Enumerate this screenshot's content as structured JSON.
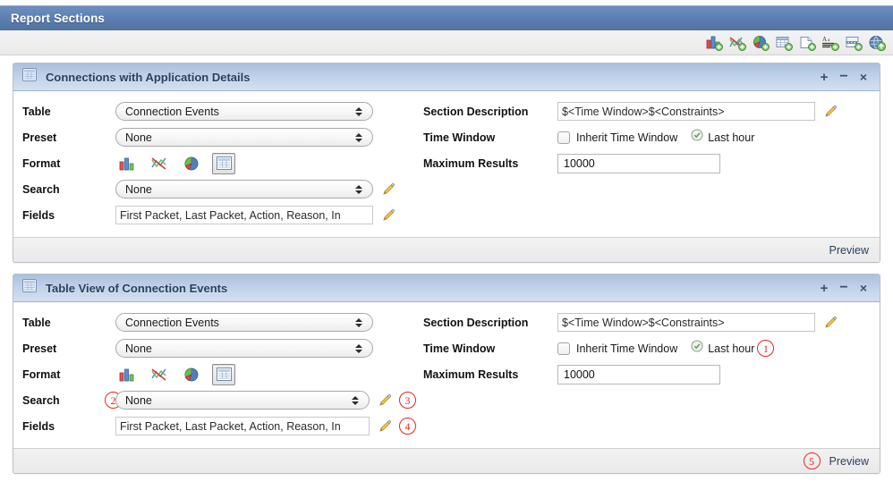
{
  "window": {
    "title": "Report Sections"
  },
  "toolbar": {
    "icons": [
      {
        "name": "add-bar-chart-icon",
        "tooltip": "Add Bar Chart Section"
      },
      {
        "name": "add-line-chart-icon",
        "tooltip": "Add Line Chart Section"
      },
      {
        "name": "add-pie-chart-icon",
        "tooltip": "Add Pie Chart Section"
      },
      {
        "name": "add-table-icon",
        "tooltip": "Add Table Section"
      },
      {
        "name": "add-page-icon",
        "tooltip": "Add Page Section"
      },
      {
        "name": "add-text-icon",
        "tooltip": "Add Text Section"
      },
      {
        "name": "add-page-break-icon",
        "tooltip": "Add Page Break"
      },
      {
        "name": "import-icon",
        "tooltip": "Import"
      }
    ]
  },
  "labels": {
    "table": "Table",
    "preset": "Preset",
    "format": "Format",
    "search": "Search",
    "fields": "Fields",
    "section_description": "Section Description",
    "time_window": "Time Window",
    "maximum_results": "Maximum Results",
    "inherit_time_window": "Inherit Time Window",
    "preview": "Preview"
  },
  "header_buttons": {
    "add": "+",
    "remove": "−",
    "close": "×"
  },
  "sections": [
    {
      "title": "Connections with Application Details",
      "icon": "table-section-icon",
      "table": "Connection Events",
      "preset": "None",
      "format_selected": 3,
      "search": "None",
      "fields": "First Packet, Last Packet, Action, Reason, In",
      "section_description": "$<Time Window>$<Constraints>",
      "inherit_time_window_checked": false,
      "time_window_value": "Last hour",
      "maximum_results": "10000",
      "preview": "Preview"
    },
    {
      "title": "Table View of Connection Events",
      "icon": "table-section-icon",
      "table": "Connection Events",
      "preset": "None",
      "format_selected": 3,
      "search": "None",
      "fields": "First Packet, Last Packet, Action, Reason, In",
      "section_description": "$<Time Window>$<Constraints>",
      "inherit_time_window_checked": false,
      "time_window_value": "Last hour",
      "maximum_results": "10000",
      "preview": "Preview"
    }
  ],
  "annotations": {
    "one": "1",
    "two": "2",
    "three": "3",
    "four": "4",
    "five": "5"
  },
  "colors": {
    "titlebar": "#5c7eb2",
    "section_header": "#bfd1e8",
    "annotation_red": "#e8271b",
    "link": "#2b3f5e"
  }
}
